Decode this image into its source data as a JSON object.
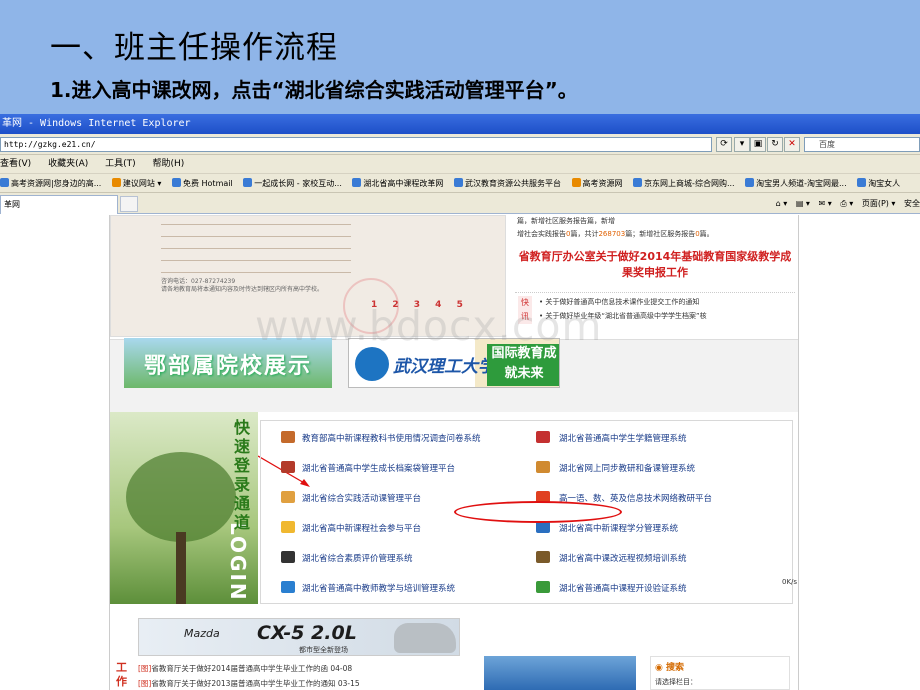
{
  "slide": {
    "title": "一、班主任操作流程",
    "subtitle": "1.进入高中课改网，点击“湖北省综合实践活动管理平台”。"
  },
  "browser": {
    "window_title": "革网 - Windows Internet Explorer",
    "address": "http://gzkg.e21.cn/",
    "search_placeholder": "百度",
    "menu": [
      "查看(V)",
      "收藏夹(A)",
      "工具(T)",
      "帮助(H)"
    ],
    "favorites": [
      "高考资源网|您身边的高...",
      "建议网站 ▾",
      "免费 Hotmail",
      "一起成长网 - 家校互动...",
      "湖北省高中课程改革网",
      "武汉教育资源公共服务平台",
      "高考资源网",
      "京东网上商城-综合网购...",
      "淘宝男人频道-淘宝网最...",
      "淘宝女人"
    ],
    "tab_label": "革网",
    "commands": [
      "页面(P) ▾",
      "安全"
    ]
  },
  "site": {
    "notice_pager": "1 2 3 4 5",
    "notice_contact": "咨询电话：027-87274239",
    "notice_footer": "请各地教育局将本通知内容及时传达到辖区内所有高中学校。",
    "stats_line1_a": "篇，新增社区服务报告",
    "stats_line1_b": "篇，新增",
    "stats_line2_a": "增社会实践报告",
    "stats_line2_b": "0",
    "stats_line2_c": "篇，共计",
    "stats_line2_d": "268703",
    "stats_line2_e": "篇；新增社区服务报告",
    "stats_line2_f": "0",
    "stats_line2_g": "篇。",
    "red_heading": "省教育厅办公室关于做好2014年基础教育国家级教学成果奖申报工作",
    "notice_tag": "快讯",
    "notices": [
      "• 关于做好普通高中信息技术课作业提交工作的通知",
      "• 关于做好毕业年级“湖北省普通高级中学学生档案”核"
    ],
    "banner_left": "鄂部属院校展示",
    "banner_uni": "武汉理工大学",
    "banner_uni_tag": "国际教育成就未来",
    "quick_label": "快速登录通道",
    "login_word": "LOGIN",
    "links_left": [
      "教育部高中新课程教科书使用情况调查问卷系统",
      "湖北省普通高中学生成长档案袋管理平台",
      "湖北省综合实践活动课管理平台",
      "湖北省高中新课程社会参与平台",
      "湖北省综合素质评价管理系统",
      "湖北省普通高中教师教学与培训管理系统"
    ],
    "links_right": [
      "湖北省普通高中学生学籍管理系统",
      "湖北省网上同步教研和备课管理系统",
      "高一语、数、英及信息技术网络教研平台",
      "湖北省高中新课程学分管理系统",
      "湖北省高中课改远程视频培训系统",
      "湖北省普通高中课程开设验证系统"
    ],
    "ad_brand": "Mazda",
    "ad_model": "CX-5 2.0L",
    "ad_slogan": "都市型全新登场",
    "news_tag": "工作",
    "news": [
      {
        "tag": "[图]",
        "text": "省教育厅关于做好2014届普通高中学生毕业工作的函  04-08"
      },
      {
        "tag": "[图]",
        "text": "省教育厅关于做好2013届普通高中学生毕业工作的通知  03-15"
      }
    ],
    "search_title": "搜索",
    "search_hint": "请选择栏目：",
    "speed": "0K/s"
  },
  "watermark": "www.bdocx.com"
}
